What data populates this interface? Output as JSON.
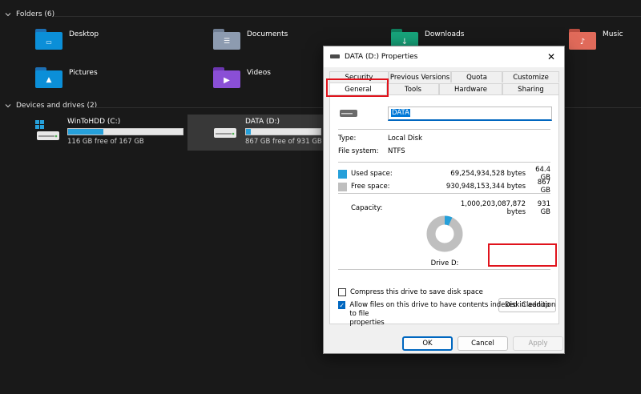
{
  "explorer": {
    "folders_header": "Folders (6)",
    "folders": [
      {
        "name": "Desktop",
        "icon": "desktop-folder-icon",
        "color": "#0b8fd8"
      },
      {
        "name": "Documents",
        "icon": "documents-folder-icon",
        "color": "#8d9bb0"
      },
      {
        "name": "Downloads",
        "icon": "downloads-folder-icon",
        "color": "#17a37a"
      },
      {
        "name": "Music",
        "icon": "music-folder-icon",
        "color": "#e06a5a"
      },
      {
        "name": "Pictures",
        "icon": "pictures-folder-icon",
        "color": "#0b8fd8"
      },
      {
        "name": "Videos",
        "icon": "videos-folder-icon",
        "color": "#8a4fd6"
      }
    ],
    "drives_header": "Devices and drives (2)",
    "drives": [
      {
        "name": "WinToHDD (C:)",
        "free_text": "116 GB free of 167 GB",
        "used_fraction": 0.305,
        "icon": "windows-drive-icon"
      },
      {
        "name": "DATA (D:)",
        "free_text": "867 GB free of 931 GB",
        "used_fraction": 0.069,
        "icon": "hard-drive-icon"
      }
    ]
  },
  "dialog": {
    "title": "DATA (D:) Properties",
    "tabs_row1": [
      "Security",
      "Previous Versions",
      "Quota",
      "Customize"
    ],
    "tabs_row2": [
      "General",
      "Tools",
      "Hardware",
      "Sharing"
    ],
    "active_tab": "General",
    "drive_label_value": "DATA",
    "type_label": "Type:",
    "type_value": "Local Disk",
    "fs_label": "File system:",
    "fs_value": "NTFS",
    "used_label": "Used space:",
    "used_bytes": "69,254,934,528 bytes",
    "used_gb": "64.4 GB",
    "free_label": "Free space:",
    "free_bytes": "930,948,153,344 bytes",
    "free_gb": "867 GB",
    "capacity_label": "Capacity:",
    "capacity_bytes": "1,000,203,087,872 bytes",
    "capacity_gb": "931 GB",
    "used_fraction": 0.069,
    "used_color": "#26a0da",
    "free_color": "#bfbfbf",
    "drive_caption": "Drive D:",
    "disk_cleanup": "Disk Cleanup",
    "compress_label": "Compress this drive to save disk space",
    "compress_checked": false,
    "index_label_line1": "Allow files on this drive to have contents indexed in addition to file",
    "index_label_line2": "properties",
    "index_checked": true,
    "ok": "OK",
    "cancel": "Cancel",
    "apply": "Apply"
  },
  "annotations": {
    "highlight_color": "#e0131c"
  }
}
